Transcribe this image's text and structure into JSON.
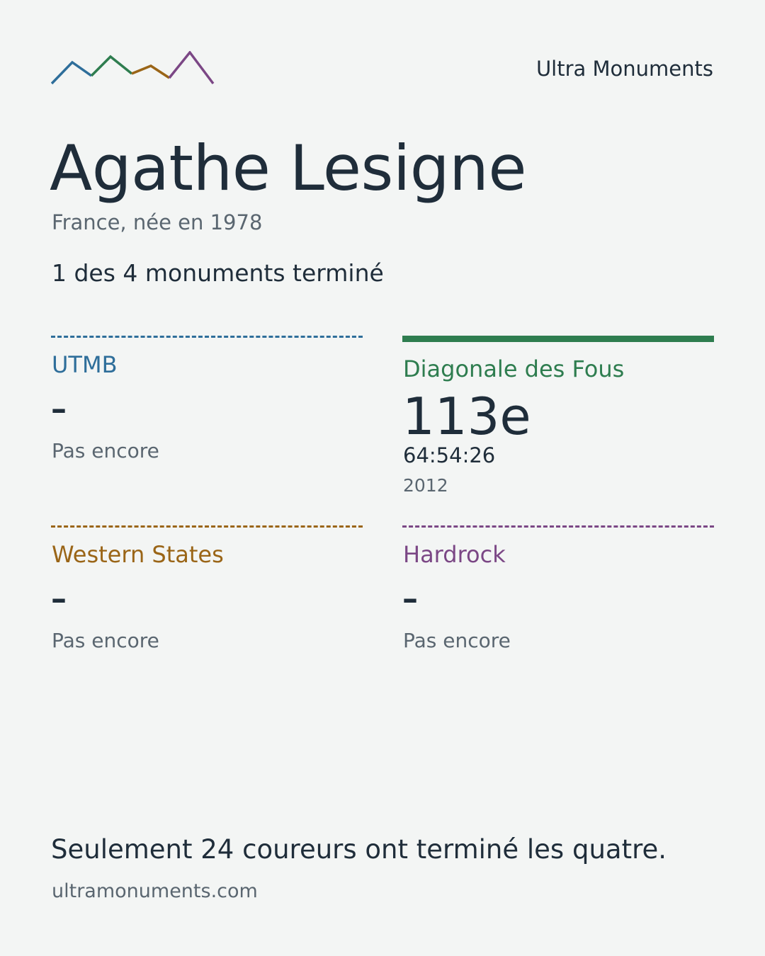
{
  "header": {
    "brand": "Ultra Monuments",
    "logo_icon": "mountain-range-icon",
    "logo_colors": [
      "#2e6e9a",
      "#2e7d4f",
      "#9a6517",
      "#7b4785"
    ]
  },
  "athlete": {
    "name": "Agathe Lesigne",
    "meta": "France, née en 1978",
    "progress": "1 des 4 monuments terminé"
  },
  "monuments": [
    {
      "name": "UTMB",
      "color": "#2e6e9a",
      "completed": false,
      "value": "–",
      "status": "Pas encore"
    },
    {
      "name": "Diagonale des Fous",
      "color": "#2e7d4f",
      "completed": true,
      "rank": "113e",
      "time": "64:54:26",
      "year": "2012"
    },
    {
      "name": "Western States",
      "color": "#9a6517",
      "completed": false,
      "value": "–",
      "status": "Pas encore"
    },
    {
      "name": "Hardrock",
      "color": "#7b4785",
      "completed": false,
      "value": "–",
      "status": "Pas encore"
    }
  ],
  "footer": {
    "note": "Seulement 24 coureurs ont terminé les quatre.",
    "url": "ultramonuments.com"
  }
}
